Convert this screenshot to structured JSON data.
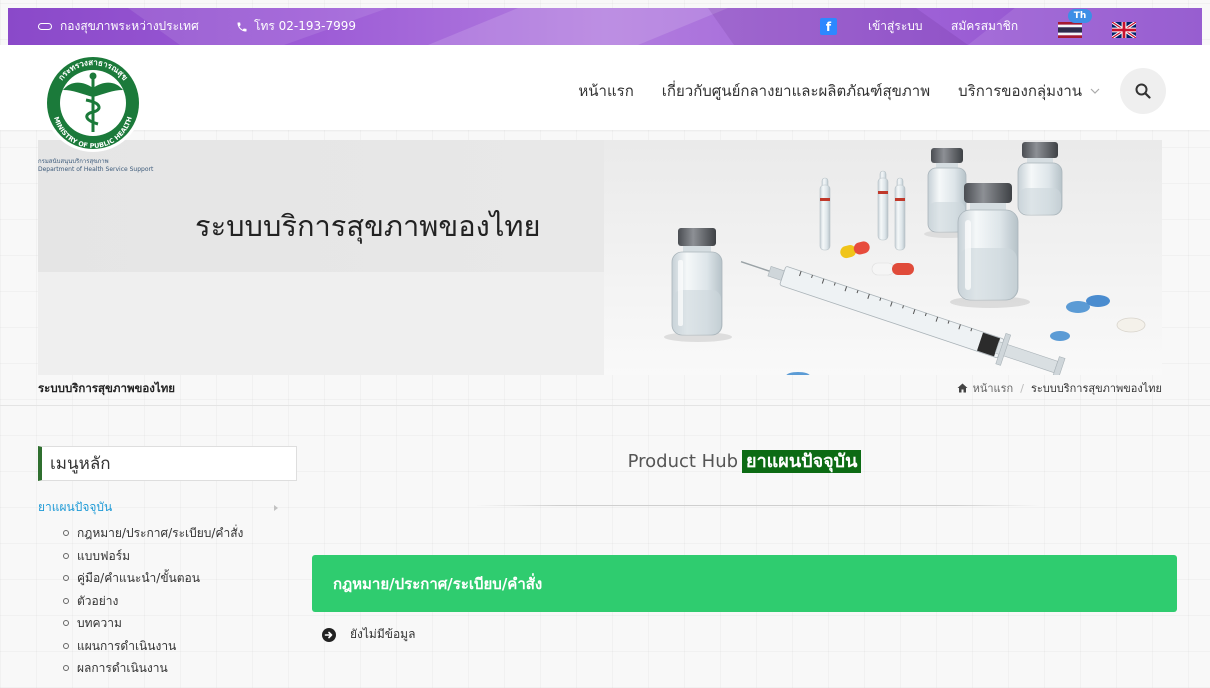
{
  "topbar": {
    "org_link": "กองสุขภาพระหว่างประเทศ",
    "phone": "โทร 02-193-7999",
    "facebook_glyph": "f",
    "login": "เข้าสู่ระบบ",
    "register": "สมัครสมาชิก",
    "lang_badge": "Th"
  },
  "logo": {
    "seal_th": "กระทรวงสาธารณสุข",
    "seal_en": "MINISTRY OF PUBLIC HEALTH",
    "dept_th": "กรมสนับสนุนบริการสุขภาพ",
    "dept_en": "Department of Health Service Support"
  },
  "nav": {
    "items": [
      "หน้าแรก",
      "เกี่ยวกับศูนย์กลางยาและผลิตภัณฑ์สุขภาพ",
      "บริการของกลุ่มงาน"
    ]
  },
  "banner": {
    "title": "ระบบบริการสุขภาพของไทย"
  },
  "page": {
    "title": "ระบบบริการสุขภาพของไทย",
    "breadcrumb": {
      "home": "หน้าแรก",
      "separator": "/",
      "current": "ระบบบริการสุขภาพของไทย"
    }
  },
  "sidebar": {
    "heading": "เมนูหลัก",
    "category": "ยาแผนปัจจุบัน",
    "items": [
      "กฎหมาย/ประกาศ/ระเบียบ/คำสั่ง",
      "แบบฟอร์ม",
      "คู่มือ/คำแนะนำ/ขั้นตอน",
      "ตัวอย่าง",
      "บทความ",
      "แผนการดำเนินงาน",
      "ผลการดำเนินงาน"
    ]
  },
  "main": {
    "heading_prefix": "Product Hub",
    "heading_highlight": "ยาแผนปัจจุบัน",
    "section_title": "กฎหมาย/ประกาศ/ระเบียบ/คำสั่ง",
    "empty_text": "ยังไม่มีข้อมูล"
  },
  "colors": {
    "topbar": "#9c5bd6",
    "section_green": "#2fcc6f",
    "highlight_green": "#0c6b14",
    "link_blue": "#1e9ad6",
    "facebook": "#2d88ff",
    "logo_green": "#1b7a3a"
  },
  "icons": {
    "org": "cloud-icon",
    "phone": "phone-icon",
    "facebook": "facebook-icon",
    "thai_flag": "thai-flag-icon",
    "uk_flag": "uk-flag-icon",
    "search": "search-icon",
    "nav_dropdown": "chevron-down-icon",
    "breadcrumb_home": "home-icon",
    "category_caret": "caret-right-icon",
    "list_bullet": "circle-bullet-icon",
    "empty_state": "arrow-circle-right-icon"
  }
}
